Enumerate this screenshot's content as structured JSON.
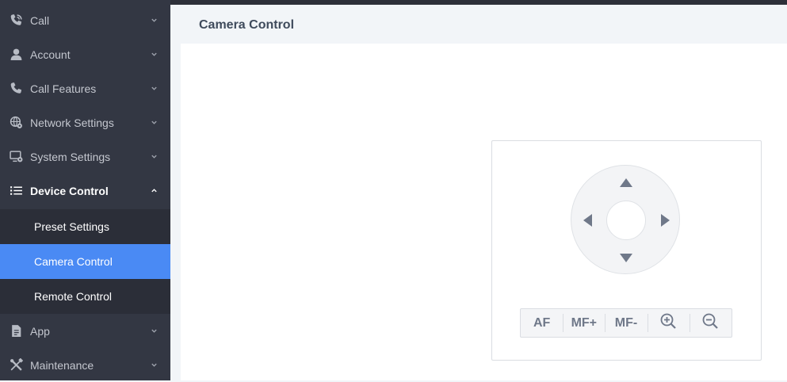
{
  "sidebar": {
    "items": [
      {
        "label": "Call",
        "icon": "phone-volume-icon",
        "expanded": false
      },
      {
        "label": "Account",
        "icon": "user-icon",
        "expanded": false
      },
      {
        "label": "Call Features",
        "icon": "phone-icon",
        "expanded": false
      },
      {
        "label": "Network Settings",
        "icon": "globe-gear-icon",
        "expanded": false
      },
      {
        "label": "System Settings",
        "icon": "monitor-gear-icon",
        "expanded": false
      },
      {
        "label": "Device Control",
        "icon": "list-icon",
        "expanded": true
      },
      {
        "label": "App",
        "icon": "document-icon",
        "expanded": false
      },
      {
        "label": "Maintenance",
        "icon": "tools-icon",
        "expanded": false
      }
    ],
    "sub_items": [
      {
        "label": "Preset Settings",
        "selected": false
      },
      {
        "label": "Camera Control",
        "selected": true
      },
      {
        "label": "Remote Control",
        "selected": false
      }
    ]
  },
  "page": {
    "title": "Camera Control"
  },
  "camera_panel": {
    "buttons": {
      "af": "AF",
      "mf_plus": "MF+",
      "mf_minus": "MF-",
      "zoom_in_icon": "zoom-in-icon",
      "zoom_out_icon": "zoom-out-icon"
    }
  },
  "colors": {
    "sidebar_bg": "#333743",
    "selected_bg": "#4a8af4",
    "icon_gray": "#6f7889"
  }
}
